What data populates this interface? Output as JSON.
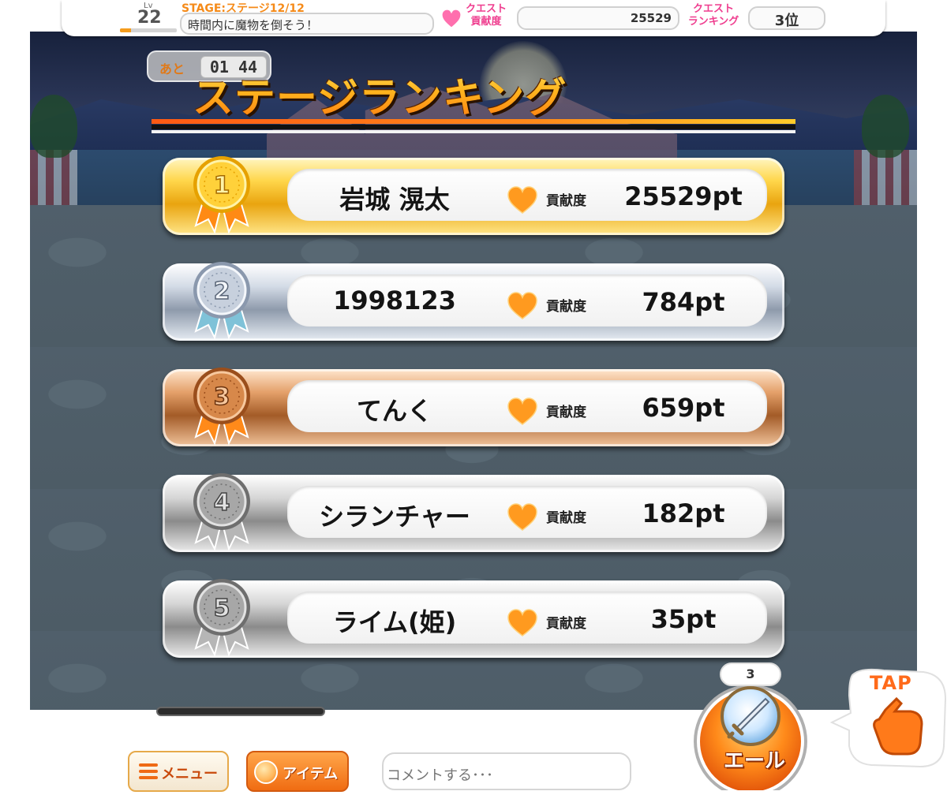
{
  "hud": {
    "lv_label": "Lv",
    "lv_value": "22",
    "lv_progress": 0.2,
    "stage_label": "STAGE:ステージ12/12",
    "stage_goal": "時間内に魔物を倒そう！",
    "quest_contrib_label_1": "クエスト",
    "quest_contrib_label_2": "貢献度",
    "quest_contrib_value": "25529",
    "quest_rank_label_1": "クエスト",
    "quest_rank_label_2": "ランキング",
    "quest_rank_value": "3位"
  },
  "timer": {
    "label": "あと",
    "value": "01 44"
  },
  "ranking": {
    "title": "ステージランキング",
    "contrib_label": "貢献度",
    "entries": [
      {
        "rank": "1",
        "name": "岩城 滉太",
        "points": "25529pt",
        "medal": "gold"
      },
      {
        "rank": "2",
        "name": "1998123",
        "points": "784pt",
        "medal": "silver"
      },
      {
        "rank": "3",
        "name": "てんく",
        "points": "659pt",
        "medal": "bronze"
      },
      {
        "rank": "4",
        "name": "シランチャー",
        "points": "182pt",
        "medal": "gray"
      },
      {
        "rank": "5",
        "name": "ライム(姫)",
        "points": "35pt",
        "medal": "gray"
      }
    ]
  },
  "bottom": {
    "menu_label": "メニュー",
    "item_label": "アイテム",
    "comment_placeholder": "コメントする･･･"
  },
  "cheer": {
    "count": "3",
    "label": "エール",
    "tap_label": "TAP"
  },
  "colors": {
    "accent_orange": "#ff8a1a",
    "pink": "#ef3e8f",
    "gold": "#ffd64a",
    "silver": "#b9c3d1",
    "bronze": "#d58a4e",
    "gray": "#a0a0a0"
  },
  "icons": {
    "heart": "heart-icon",
    "medal": "medal-icon",
    "menu": "hamburger-icon",
    "item": "orb-icon",
    "sword": "sword-icon",
    "hand": "pointing-hand-icon"
  }
}
